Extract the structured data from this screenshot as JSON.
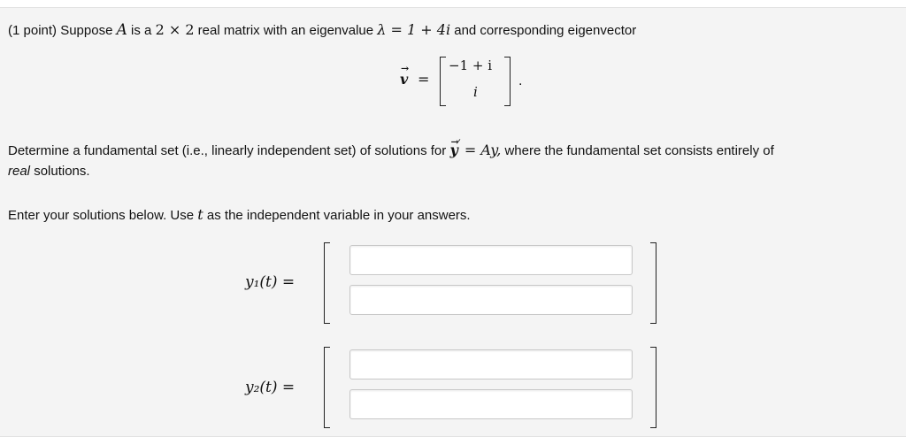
{
  "problem": {
    "points": "(1 point)",
    "intro_1": "Suppose",
    "matrix_A": "A",
    "intro_2": "is a",
    "dims": "2 × 2",
    "intro_3": "real matrix with an eigenvalue",
    "eigenvalue": "λ = 1 + 4i",
    "intro_4": "and corresponding eigenvector",
    "eigvec_name": "v",
    "eigvec_top": "−1 + i",
    "eigvec_bottom": "i",
    "determine_1": "Determine a fundamental set (i.e., linearly independent set) of solutions for",
    "ode": "= Ay,",
    "determine_2": "where the fundamental set consists entirely of",
    "determine_real": "real",
    "determine_3": "solutions.",
    "enter": "Enter your solutions below. Use",
    "t_var": "t",
    "enter_2": "as the independent variable in your answers."
  },
  "answers": {
    "y1_label": "y₁(t) =",
    "y2_label": "y₂(t) =",
    "y1_top_value": "",
    "y1_bottom_value": "",
    "y2_top_value": "",
    "y2_bottom_value": ""
  }
}
